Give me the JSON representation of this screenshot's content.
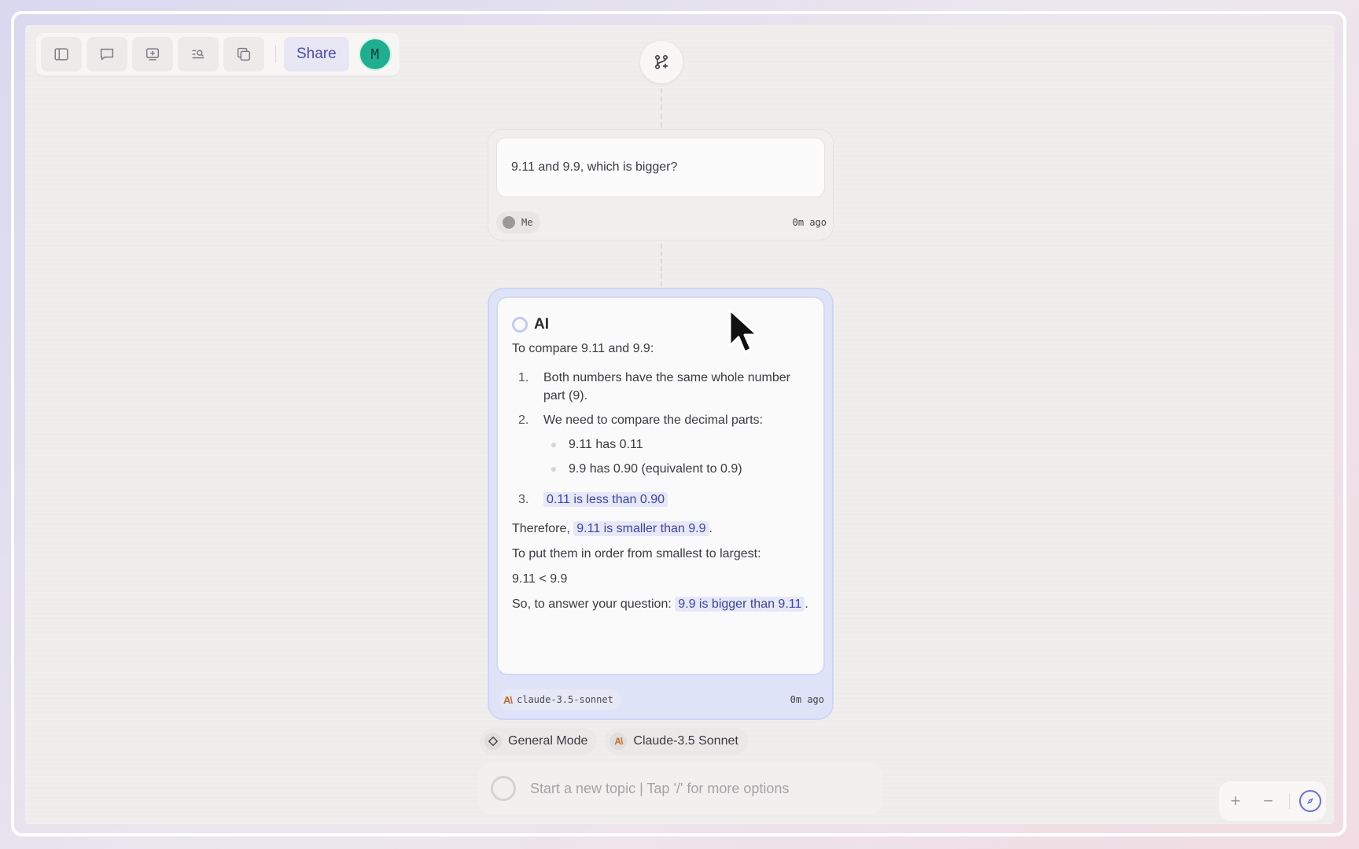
{
  "toolbar": {
    "buttons": [
      "sidebar-toggle",
      "comment",
      "add-frame",
      "search-list",
      "copy"
    ],
    "share_label": "Share",
    "avatar_letter": "M"
  },
  "user_message": {
    "text": "9.11 and 9.9, which is bigger?",
    "author": "Me",
    "time": "0m ago"
  },
  "ai_message": {
    "label": "AI",
    "intro": "To compare 9.11 and 9.9:",
    "steps": [
      {
        "num": "1.",
        "text": "Both numbers have the same whole number part (9)."
      },
      {
        "num": "2.",
        "text": "We need to compare the decimal parts:"
      },
      {
        "num": "3.",
        "text": "0.11 is less than 0.90"
      }
    ],
    "sub_items": [
      "9.11 has 0.11",
      "9.9 has 0.90 (equivalent to 0.9)"
    ],
    "therefore_prefix": "Therefore,",
    "therefore_highlight": "9.11 is smaller than 9.9",
    "therefore_suffix": ".",
    "order_line": "To put them in order from smallest to largest:",
    "order_value": "9.11 < 9.9",
    "answer_prefix": "So, to answer your question:",
    "answer_highlight": "9.9 is bigger than 9.11",
    "answer_suffix": ".",
    "model": "claude-3.5-sonnet",
    "time": "0m ago"
  },
  "chips": {
    "mode": "General Mode",
    "model": "Claude-3.5 Sonnet"
  },
  "input": {
    "placeholder": "Start a new topic | Tap '/' for more options"
  },
  "zoom": {
    "plus": "+",
    "minus": "−"
  },
  "colors": {
    "accent": "#4d4fa7",
    "avatar": "#1fae8f",
    "ai_card": "#dfe3f7",
    "highlight_bg": "#e6e8f8"
  }
}
